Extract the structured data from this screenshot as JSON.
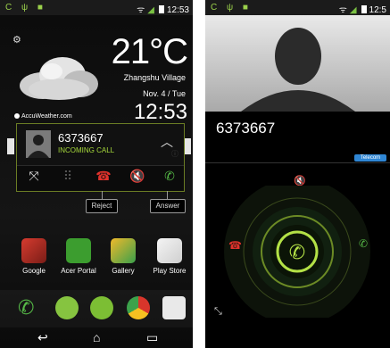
{
  "left": {
    "status": {
      "icons_left": "C ψ ■",
      "time": "12:53"
    },
    "weather": {
      "temperature": "21°C",
      "location": "Zhangshu Village",
      "date": "Nov. 4 / Tue",
      "time": "12:53",
      "provider": "AccuWeather.com"
    },
    "call": {
      "number": "6373667",
      "status": "INCOMING CALL",
      "reject_label": "Reject",
      "answer_label": "Answer"
    },
    "apps": [
      {
        "label": "Google"
      },
      {
        "label": "Acer Portal"
      },
      {
        "label": "Gallery"
      },
      {
        "label": "Play Store"
      }
    ],
    "dock": [
      "phone-icon",
      "messaging-icon",
      "app-drawer-icon",
      "chrome-icon",
      "camera-icon"
    ],
    "nav": [
      "back-icon",
      "home-icon",
      "recents-icon"
    ]
  },
  "right": {
    "status": {
      "icons_left": "C ψ ■",
      "time": "12:5"
    },
    "call": {
      "number": "6373667",
      "carrier": "Telecom"
    }
  },
  "colors": {
    "accent_green": "#a6d93b",
    "reject_red": "#e0322c",
    "answer_green": "#56b947",
    "carrier_blue": "#2f86d4"
  }
}
